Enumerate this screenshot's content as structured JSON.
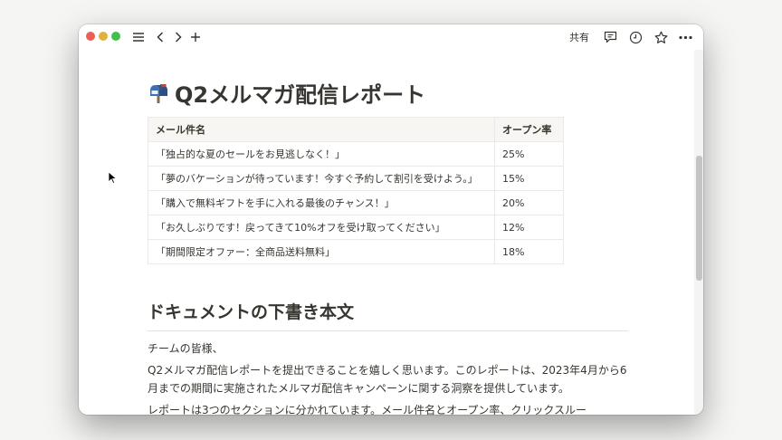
{
  "toolbar": {
    "share_label": "共有",
    "icons": [
      "sidebar-menu-icon",
      "back-arrow-icon",
      "forward-arrow-icon",
      "plus-icon",
      "comment-icon",
      "history-clock-icon",
      "star-icon",
      "more-dots-icon"
    ]
  },
  "page": {
    "title": "Q2メルマガ配信レポート",
    "title_icon": "mailbox-icon"
  },
  "table": {
    "headers": [
      "メール件名",
      "オープン率"
    ],
    "rows": [
      [
        "「独占的な夏のセールをお見逃しなく！」",
        "25%"
      ],
      [
        "「夢のバケーションが待っています！今すぐ予約して割引を受けよう。」",
        "15%"
      ],
      [
        "「購入で無料ギフトを手に入れる最後のチャンス！」",
        "20%"
      ],
      [
        "「お久しぶりです！戻ってきて10%オフを受け取ってください」",
        "12%"
      ],
      [
        "「期間限定オファー：全商品送料無料」",
        "18%"
      ]
    ]
  },
  "section": {
    "heading": "ドキュメントの下書き本文",
    "paragraphs": [
      "チームの皆様、",
      "Q2メルマガ配信レポートを提出できることを嬉しく思います。このレポートは、2023年4月から6月までの期間に実施されたメルマガ配信キャンペーンに関する洞察を提供しています。",
      "レポートは3つのセクションに分かれています。メール件名とオープン率、クリックスルー"
    ]
  },
  "colors": {
    "text": "#37352f",
    "table_header_bg": "#f7f6f3",
    "border": "#e9e9e7"
  }
}
